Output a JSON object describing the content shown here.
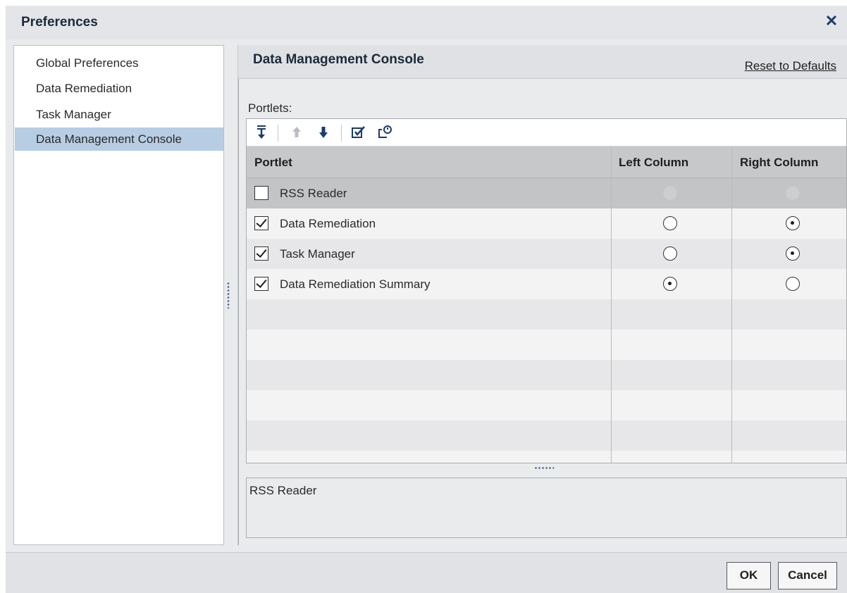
{
  "dialog": {
    "title": "Preferences",
    "close_symbol": "✕"
  },
  "nav": {
    "items": [
      {
        "label": "Global Preferences",
        "selected": false
      },
      {
        "label": "Data Remediation",
        "selected": false
      },
      {
        "label": "Task Manager",
        "selected": false
      },
      {
        "label": "Data Management Console",
        "selected": true
      }
    ]
  },
  "panel": {
    "title": "Data Management Console",
    "reset_label": "Reset to Defaults",
    "portlets_label": "Portlets:"
  },
  "toolbar": {
    "buttons": [
      {
        "icon": "move-to-bottom-icon",
        "enabled": true
      },
      {
        "icon": "move-up-icon",
        "enabled": false
      },
      {
        "icon": "move-down-icon",
        "enabled": true
      },
      {
        "icon": "check-all-icon",
        "enabled": true
      },
      {
        "icon": "restore-icon",
        "enabled": true
      }
    ]
  },
  "table": {
    "columns": [
      "Portlet",
      "Left Column",
      "Right Column"
    ],
    "rows": [
      {
        "portlet": "RSS Reader",
        "checked": false,
        "column": "none",
        "selected": true
      },
      {
        "portlet": "Data Remediation",
        "checked": true,
        "column": "right",
        "selected": false
      },
      {
        "portlet": "Task Manager",
        "checked": true,
        "column": "right",
        "selected": false
      },
      {
        "portlet": "Data Remediation Summary",
        "checked": true,
        "column": "left",
        "selected": false
      }
    ]
  },
  "description": {
    "text": "RSS Reader"
  },
  "footer": {
    "ok_label": "OK",
    "cancel_label": "Cancel"
  },
  "colors": {
    "selection": "#b7cde3",
    "accent": "#1d3b6b"
  }
}
